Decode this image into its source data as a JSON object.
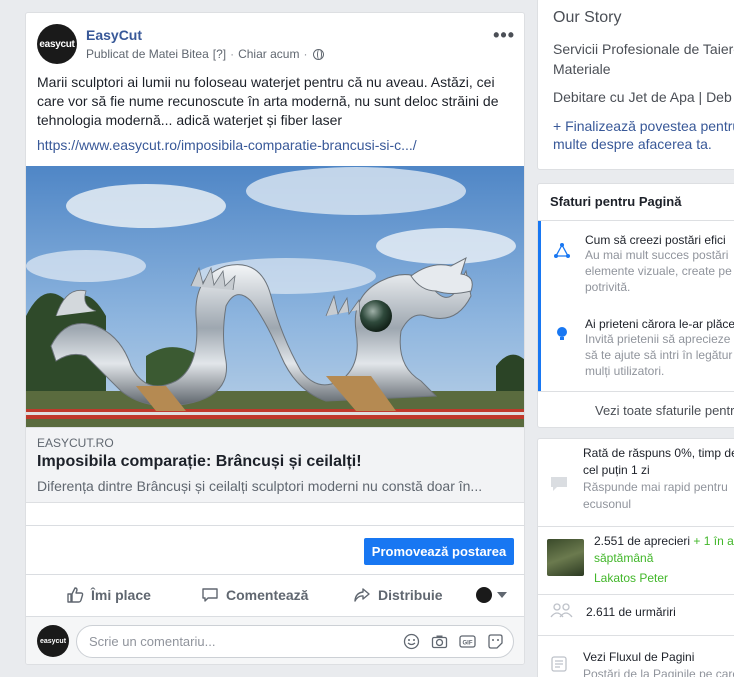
{
  "post": {
    "page_name": "EasyCut",
    "avatar_text": "easycut",
    "published_by": "Publicat de Matei Bitea",
    "published_help": "[?]",
    "time": "Chiar acum",
    "body": "Marii sculptori ai lumii nu foloseau waterjet pentru că nu aveau. Astăzi, cei care vor să fie nume recunoscute în arta modernă, nu sunt deloc străini de tehnologia modernă... adică waterjet și fiber laser",
    "link": "https://www.easycut.ro/imposibila-comparatie-brancusi-si-c.../",
    "link_preview": {
      "domain": "EASYCUT.RO",
      "title": "Imposibila comparație: Brâncuși și ceilalți!",
      "description": "Diferența dintre Brâncuși și ceilalți sculptori moderni nu constă doar în..."
    },
    "promote_label": "Promovează postarea",
    "actions": {
      "like": "Îmi place",
      "comment": "Comentează",
      "share": "Distribuie"
    },
    "comment_placeholder": "Scrie un comentariu..."
  },
  "sidebar": {
    "story": {
      "title": "Our Story",
      "line1": "Servicii Profesionale de Taiere Materiale",
      "line2": "Debitare cu Jet de Apa | Deb",
      "add_story": "+ Finalizează povestea pentru multe despre afacerea ta."
    },
    "tips": {
      "title": "Sfaturi pentru Pagină",
      "items": [
        {
          "title": "Cum să creezi postări efici",
          "desc1": "Au mai mult succes postări",
          "desc2": "elemente vizuale, create pe",
          "desc3": "potrivită."
        },
        {
          "title": "Ai prieteni cărora le-ar plăce",
          "desc1": "Invită prietenii să aprecieze",
          "desc2": "să te ajute să intri în legătur",
          "desc3": "mulți utilizatori."
        }
      ],
      "see_all": "Vezi toate sfaturile pentru"
    },
    "stats": {
      "response_line1": "Rată de răspuns 0%, timp de",
      "response_line2": "cel puțin 1 zi",
      "response_sub1": "Răspunde mai rapid pentru",
      "response_sub2": "ecusonul",
      "likes": "2.551 de aprecieri",
      "likes_delta": "+ 1 în a",
      "likes_period": "săptămână",
      "liker_name": "Lakatos Peter",
      "follows": "2.611 de urmăriri",
      "feed_line1": "Vezi Fluxul de Pagini",
      "feed_line2": "Postări de la Paginile pe care"
    }
  }
}
